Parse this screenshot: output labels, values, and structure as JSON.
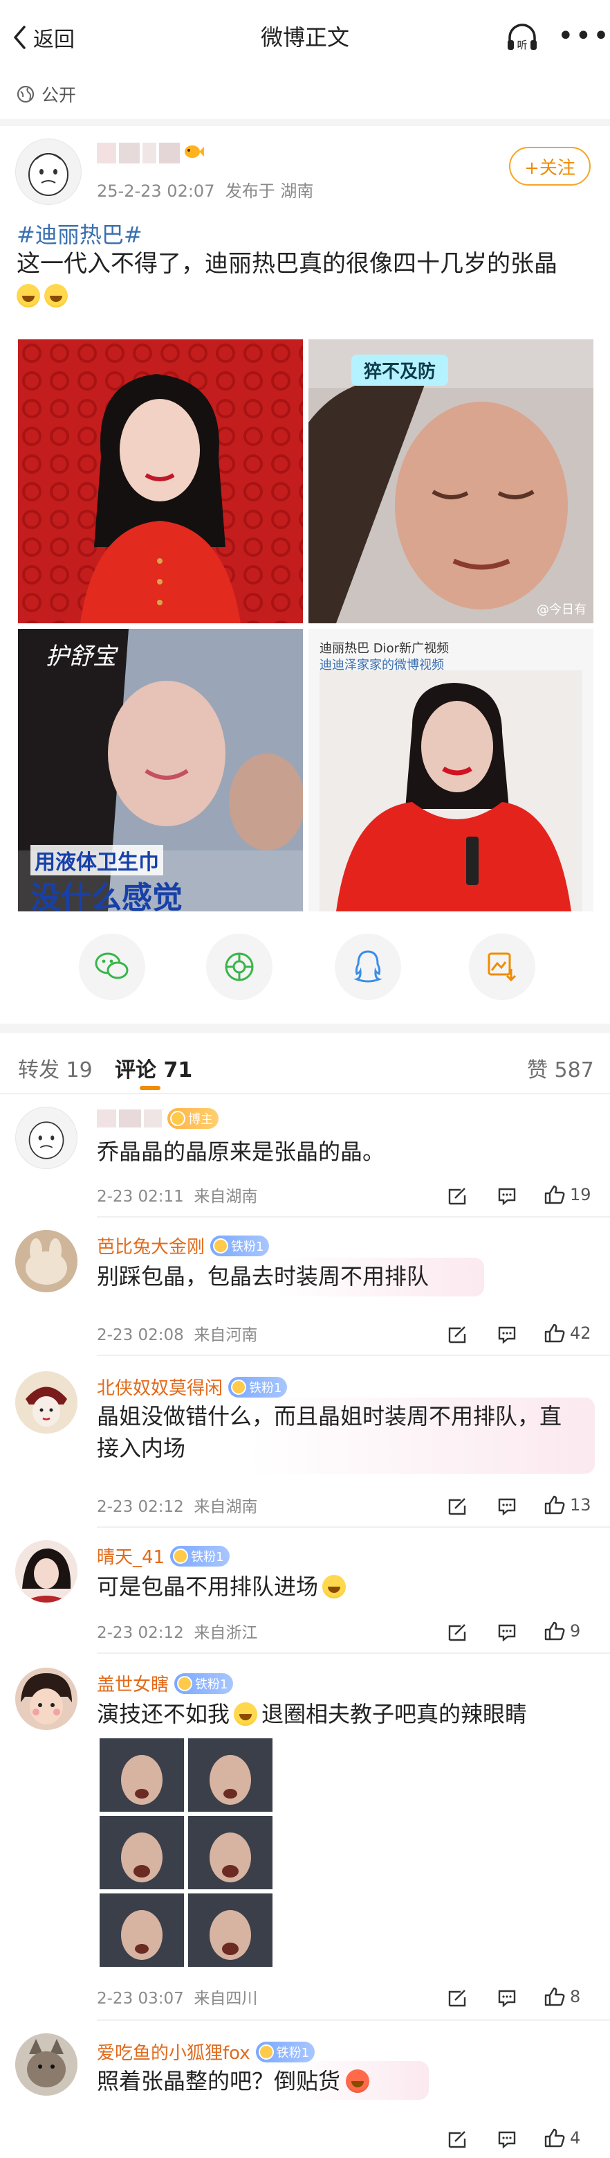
{
  "header": {
    "back_label": "返回",
    "title": "微博正文",
    "listen_label": "听",
    "more_label": "•••"
  },
  "visibility": "公开",
  "post": {
    "time": "25-2-23 02:07",
    "source": "发布于 湖南",
    "follow_label": "+关注",
    "hashtag": "#迪丽热巴#",
    "text": "这一代入不得了，迪丽热巴真的很像四十几岁的张晶",
    "images": [
      {
        "caption": ""
      },
      {
        "caption": "猝不及防",
        "watermark": "@今日有"
      },
      {
        "caption": "护舒宝",
        "subtitle_top": "用液体卫生巾",
        "subtitle_bottom": "没什么感觉"
      },
      {
        "caption": "迪丽热巴 Dior新广视频",
        "subcaption": "迪迪泽家家的微博视频"
      }
    ]
  },
  "tabs": {
    "repost": "转发 19",
    "comment": "评论 71",
    "like": "赞 587"
  },
  "comments": [
    {
      "name": "",
      "badge": "博主",
      "text": "乔晶晶的晶原来是张晶的晶。",
      "time": "2-23 02:11",
      "loc": "来自湖南",
      "likes": "19"
    },
    {
      "name": "芭比兔大金刚",
      "badge": "铁粉1",
      "text": "别踩包晶，包晶去时装周不用排队",
      "time": "2-23 02:08",
      "loc": "来自河南",
      "likes": "42"
    },
    {
      "name": "北侠奴奴莫得闲",
      "badge": "铁粉1",
      "text": "晶姐没做错什么，而且晶姐时装周不用排队，直接入内场",
      "time": "2-23 02:12",
      "loc": "来自湖南",
      "likes": "13"
    },
    {
      "name": "晴天_41",
      "badge": "铁粉1",
      "text": "可是包晶不用排队进场",
      "time": "2-23 02:12",
      "loc": "来自浙江",
      "likes": "9"
    },
    {
      "name": "盖世女瞎",
      "badge": "铁粉1",
      "text_a": "演技还不如我",
      "text_b": "退圈相夫教子吧真的辣眼睛",
      "time": "2-23 03:07",
      "loc": "来自四川",
      "likes": "8"
    },
    {
      "name": "爱吃鱼的小狐狸fox",
      "badge": "铁粉1",
      "text": "照着张晶整的吧？倒贴货",
      "likes": "4"
    }
  ],
  "colors": {
    "accent": "#f08c00",
    "link": "#3a6fb0",
    "name": "#e26a1a"
  },
  "icons": [
    "back-arrow-icon",
    "listen-icon",
    "globe-icon",
    "wechat-icon",
    "moments-icon",
    "qq-icon",
    "save-image-icon",
    "reply-icon",
    "comment-icon",
    "like-icon"
  ]
}
